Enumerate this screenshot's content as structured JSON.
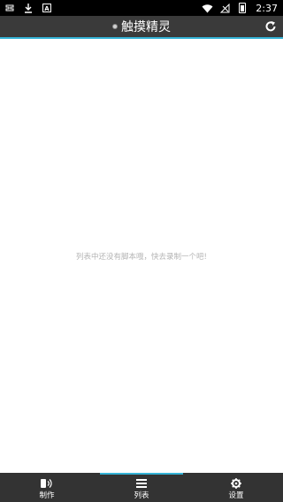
{
  "status_bar": {
    "time": "2:37",
    "left_icons": [
      "bug-icon",
      "download-icon",
      "a-box-icon"
    ],
    "right_icons": [
      "wifi-icon",
      "no-signal-icon",
      "battery-charging-icon"
    ]
  },
  "app_bar": {
    "title": "触摸精灵",
    "icons": [
      "app-dot-icon",
      "refresh-icon"
    ],
    "accent_color": "#35b3d6"
  },
  "main": {
    "empty_message": "列表中还没有脚本哦，快去录制一个吧!"
  },
  "tab_bar": {
    "tabs": [
      {
        "label": "制作",
        "icon": "make-icon"
      },
      {
        "label": "列表",
        "icon": "list-icon",
        "selected": true
      },
      {
        "label": "设置",
        "icon": "gear-icon"
      }
    ]
  },
  "colors": {
    "status_bar": "#000000",
    "app_bar": "#3a3a3a",
    "tab_bar": "#333333",
    "accent": "#35b3d6",
    "background": "#ffffff",
    "empty_text": "#b4b4b4"
  }
}
